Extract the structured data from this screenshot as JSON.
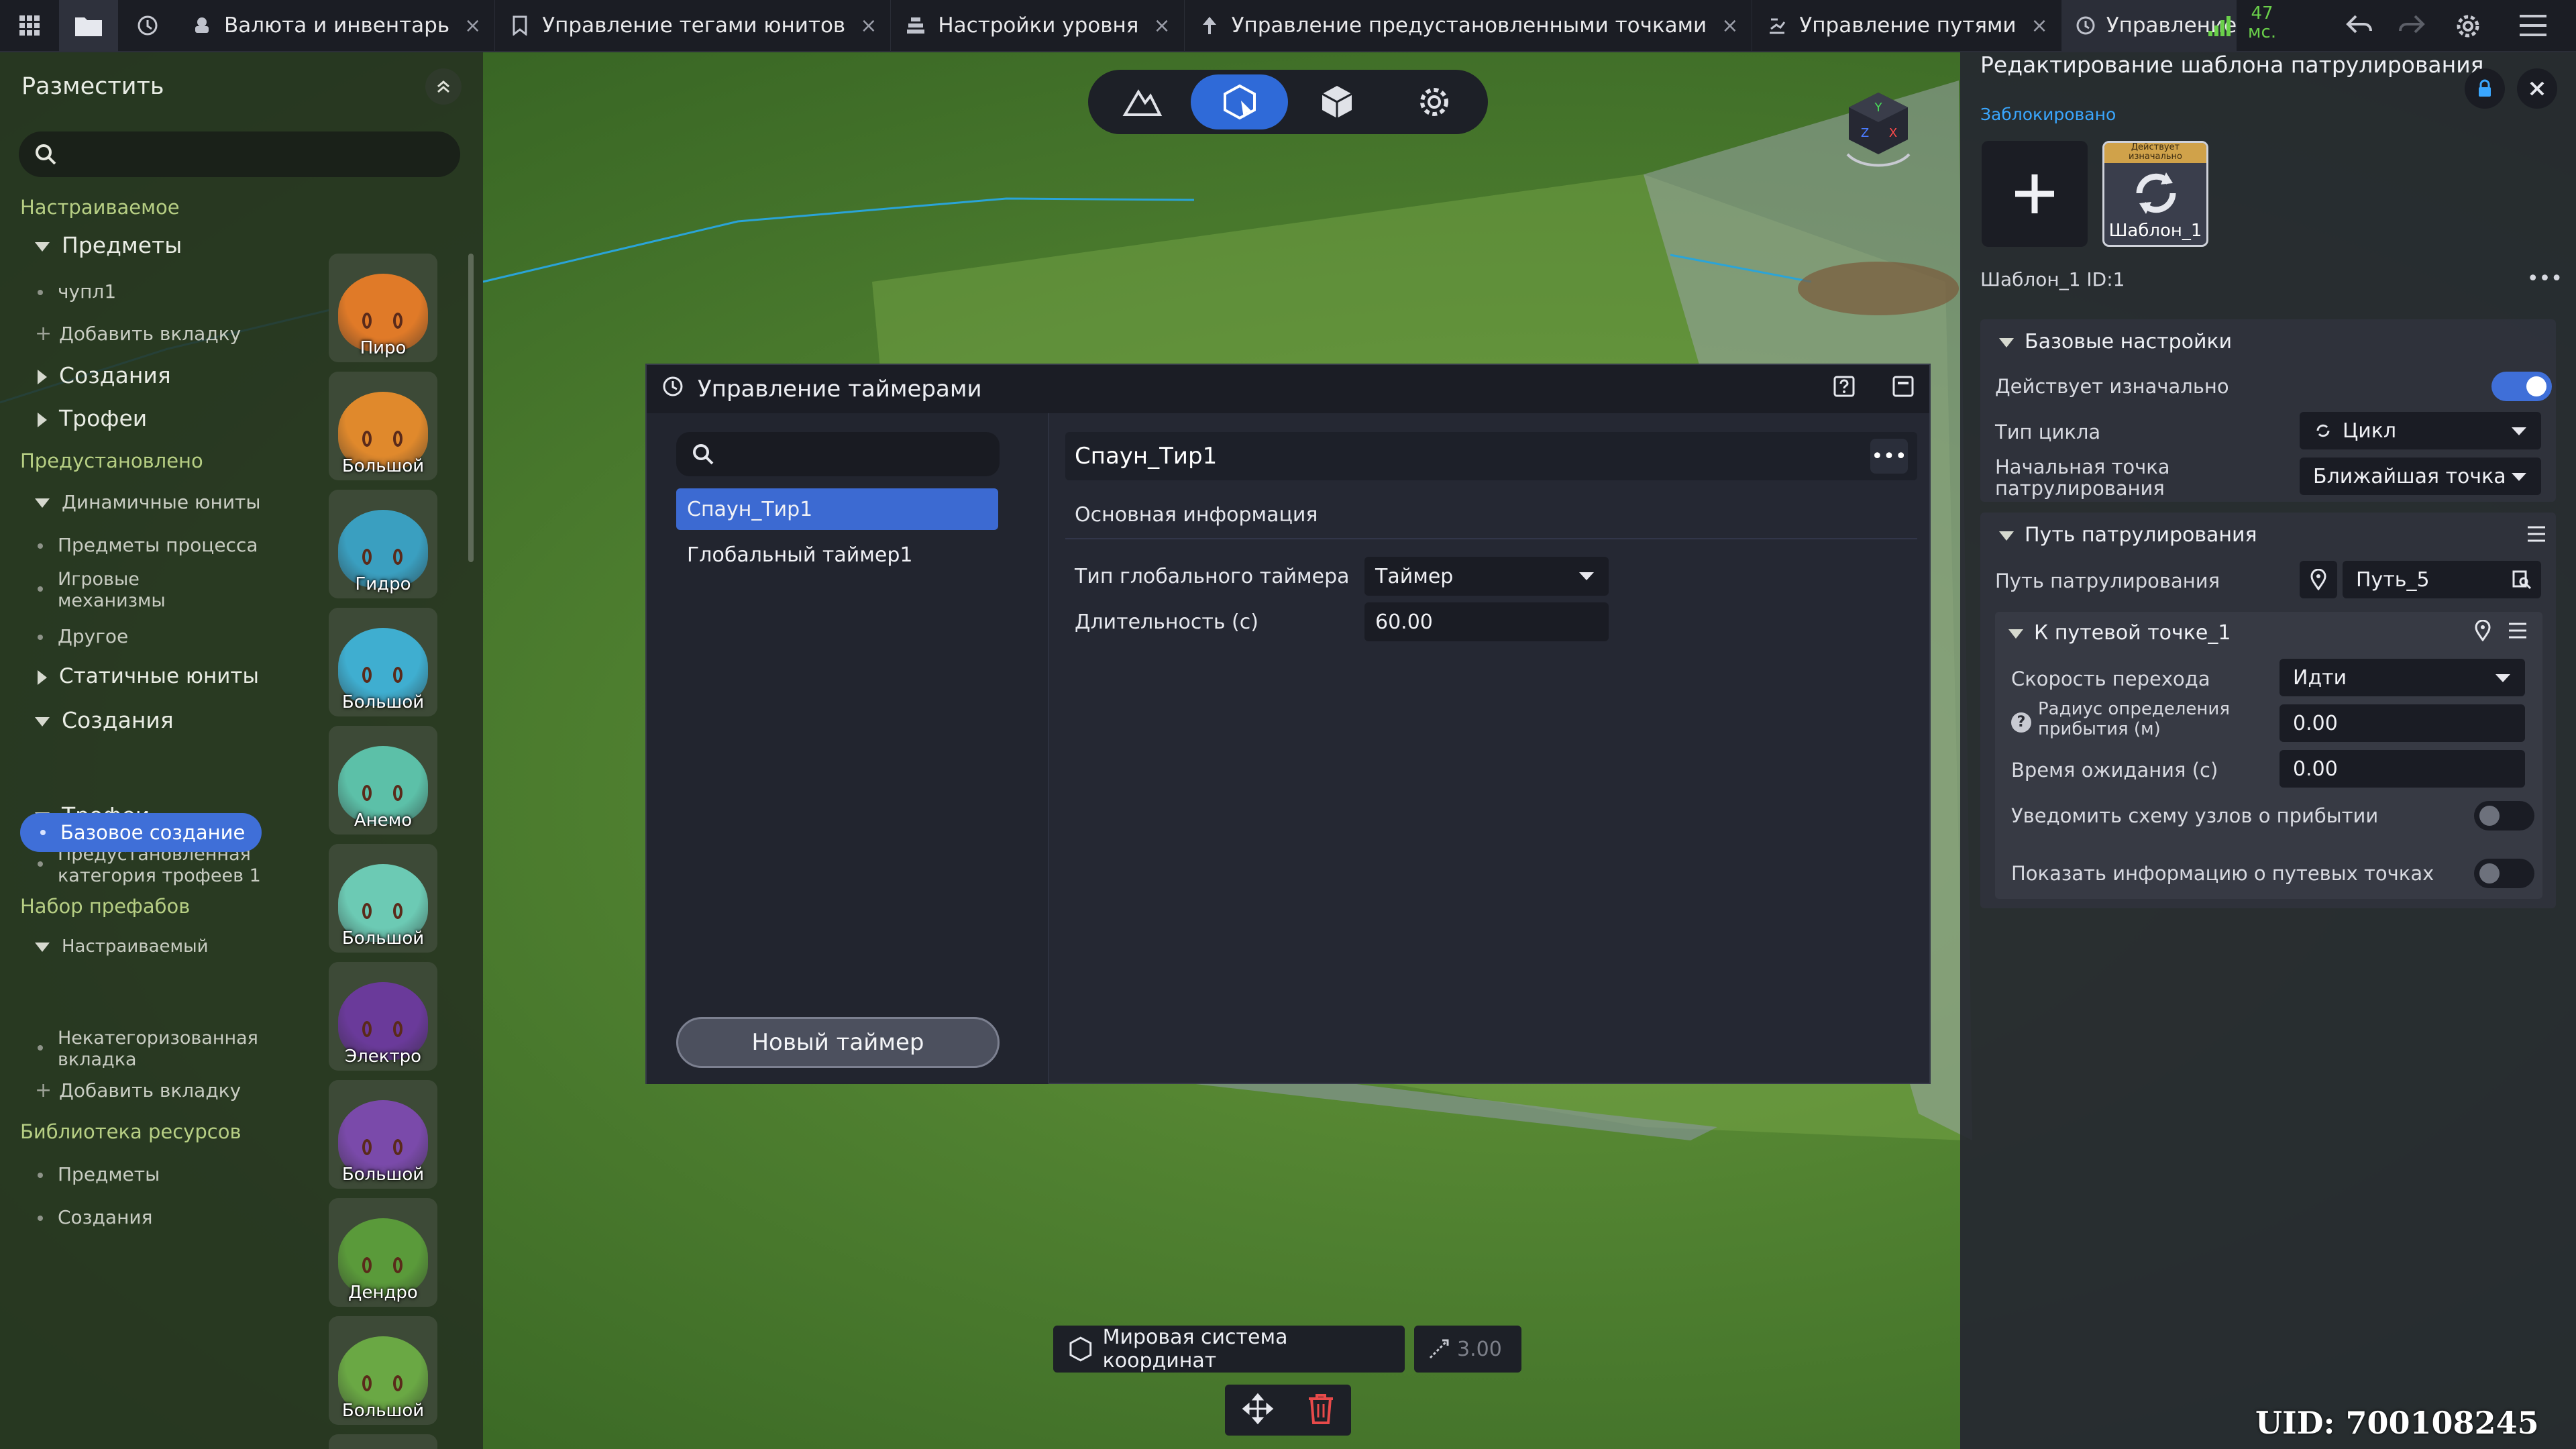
{
  "topbar": {
    "tabs": [
      {
        "label": "Валюта и инвентарь",
        "icon": "coins-icon"
      },
      {
        "label": "Управление тегами юнитов",
        "icon": "bookmark-icon"
      },
      {
        "label": "Настройки уровня",
        "icon": "level-settings-icon"
      },
      {
        "label": "Управление предустановленными точками",
        "icon": "pin-icon"
      },
      {
        "label": "Управление путями",
        "icon": "path-icon"
      },
      {
        "label": "Управление та",
        "icon": "clock-icon"
      }
    ],
    "close_glyph": "×",
    "ping_value": "47",
    "ping_unit": "мс."
  },
  "left_panel": {
    "title": "Разместить",
    "tree": {
      "customizable": "Настраиваемое",
      "items": "Предметы",
      "chupl": "чупл1",
      "add_tab": "Добавить вкладку",
      "creatures": "Создания",
      "trophies": "Трофеи",
      "preset": "Предустановлено",
      "dynamic_units": "Динамичные юниты",
      "process_items": "Предметы процесса",
      "game_mechanisms": "Игровые механизмы",
      "other": "Другое",
      "static_units": "Статичные юниты",
      "creatures2": "Создания",
      "base_creature": "Базовое создание",
      "trophies2": "Трофеи",
      "preset_trophy_cat": "Предустановленная категория трофеев 1",
      "prefab_set": "Набор префабов",
      "customizable2": "Настраиваемый",
      "uncategorized_tab": "Некатегоризованная вкладка",
      "add_tab2": "Добавить вкладку",
      "resource_library": "Библиотека ресурсов",
      "res_items": "Предметы",
      "res_creatures": "Создания"
    },
    "tiles": [
      {
        "label": "Пиро",
        "color": "#e07a28"
      },
      {
        "label": "Большой",
        "color": "#e0892c"
      },
      {
        "label": "Гидро",
        "color": "#3a9fc0"
      },
      {
        "label": "Большой",
        "color": "#3faed0"
      },
      {
        "label": "Анемо",
        "color": "#5cc0a8"
      },
      {
        "label": "Большой",
        "color": "#6ccab4"
      },
      {
        "label": "Электро",
        "color": "#6a3a9a"
      },
      {
        "label": "Большой",
        "color": "#7a4aaa"
      },
      {
        "label": "Дендро",
        "color": "#5a9a3a"
      },
      {
        "label": "Большой",
        "color": "#6aa844"
      }
    ]
  },
  "modal": {
    "title": "Управление таймерами",
    "timers": [
      "Спаун_Тир1",
      "Глобальный таймер1"
    ],
    "selected_timer": "Спаун_Тир1",
    "new_timer_label": "Новый таймер",
    "detail": {
      "name": "Спаун_Тир1",
      "section": "Основная информация",
      "type_label": "Тип глобального таймера",
      "type_value": "Таймер",
      "duration_label": "Длительность (с)",
      "duration_value": "60.00"
    }
  },
  "right_panel": {
    "title": "Редактирование шаблона патрулирования",
    "locked_text": "Заблокировано",
    "template_badge": "Действует изначально",
    "template_name": "Шаблон_1",
    "template_id_line": "Шаблон_1 ID:1",
    "basic": {
      "header": "Базовые настройки",
      "initially_active_label": "Действует изначально",
      "initially_active": true,
      "cycle_type_label": "Тип цикла",
      "cycle_type_value": "Цикл",
      "start_point_label": "Начальная точка патрулирования",
      "start_point_value": "Ближайшая точка"
    },
    "path": {
      "header": "Путь патрулирования",
      "path_label": "Путь патрулирования",
      "path_value": "Путь_5",
      "waypoint_header": "К путевой точке_1",
      "speed_label": "Скорость перехода",
      "speed_value": "Идти",
      "radius_label": "Радиус определения прибытия (м)",
      "radius_value": "0.00",
      "wait_label": "Время ожидания (с)",
      "wait_value": "0.00",
      "notify_label": "Уведомить схему узлов о прибытии",
      "notify": false,
      "show_info_label": "Показать информацию о путевых точках",
      "show_info": false
    }
  },
  "bottom": {
    "coord_system": "Мировая система координат",
    "scale_value": "3.00"
  },
  "uid": "UID: 700108245"
}
